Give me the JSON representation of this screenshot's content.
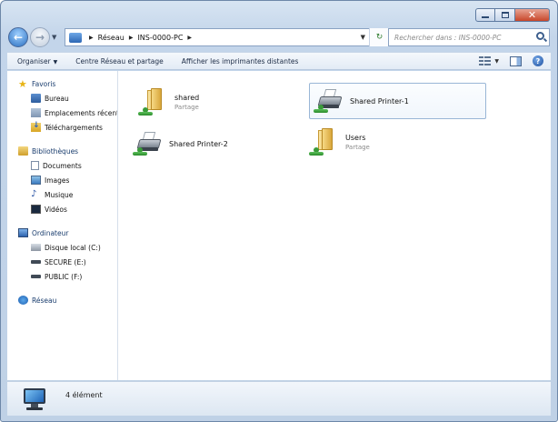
{
  "window": {
    "caption_buttons": [
      "minimize",
      "maximize",
      "close"
    ]
  },
  "address_bar": {
    "breadcrumbs": [
      "Réseau",
      "INS-0000-PC"
    ]
  },
  "search": {
    "placeholder": "Rechercher dans : INS-0000-PC"
  },
  "toolbar": {
    "organize_label": "Organiser",
    "network_center_label": "Centre Réseau et partage",
    "show_printers_label": "Afficher les imprimantes distantes"
  },
  "sidebar": {
    "favorites": {
      "label": "Favoris",
      "items": [
        {
          "label": "Bureau",
          "icon": "desktop-icon"
        },
        {
          "label": "Emplacements récents",
          "icon": "recent-places-icon"
        },
        {
          "label": "Téléchargements",
          "icon": "downloads-icon"
        }
      ]
    },
    "libraries": {
      "label": "Bibliothèques",
      "items": [
        {
          "label": "Documents",
          "icon": "document-icon"
        },
        {
          "label": "Images",
          "icon": "image-icon"
        },
        {
          "label": "Musique",
          "icon": "music-icon"
        },
        {
          "label": "Vidéos",
          "icon": "video-icon"
        }
      ]
    },
    "computer": {
      "label": "Ordinateur",
      "items": [
        {
          "label": "Disque local (C:)",
          "icon": "local-disk-icon"
        },
        {
          "label": "SECURE (E:)",
          "icon": "removable-drive-icon"
        },
        {
          "label": "PUBLIC (F:)",
          "icon": "removable-drive-icon"
        }
      ]
    },
    "network": {
      "label": "Réseau"
    }
  },
  "items": [
    {
      "name": "shared",
      "subtitle": "Partage",
      "type": "folder"
    },
    {
      "name": "Shared Printer-1",
      "subtitle": "",
      "type": "printer"
    },
    {
      "name": "Shared Printer-2",
      "subtitle": "",
      "type": "printer"
    },
    {
      "name": "Users",
      "subtitle": "Partage",
      "type": "folder"
    }
  ],
  "status": {
    "count_text": "4 élément"
  }
}
